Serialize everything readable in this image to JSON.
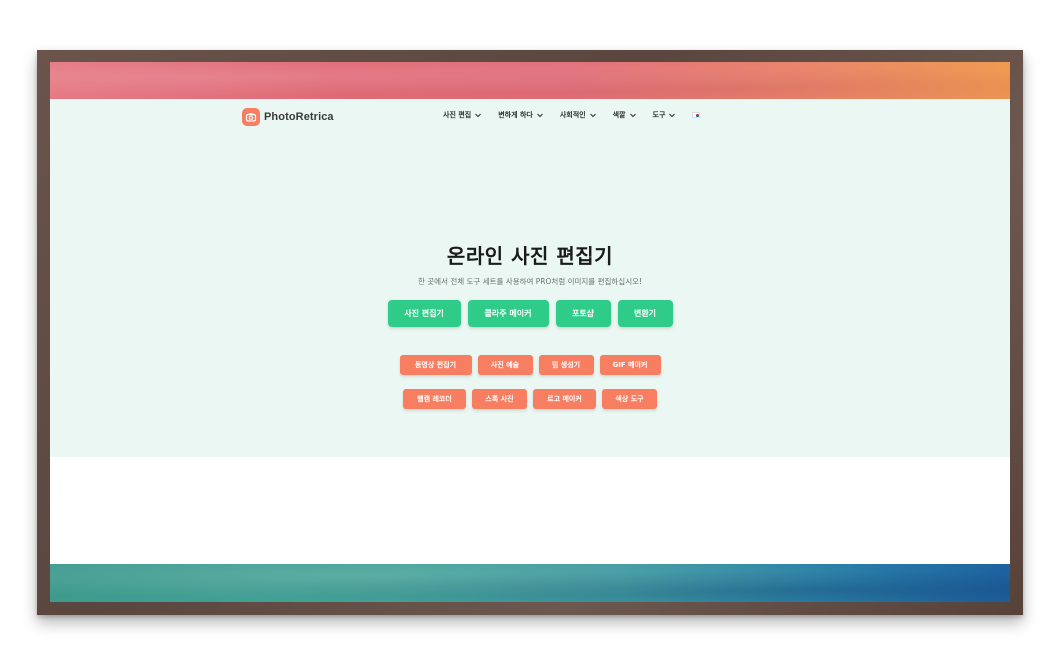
{
  "brand": {
    "name": "PhotoRetrica",
    "accent": "#f87e62"
  },
  "nav": {
    "items": [
      {
        "label": "사진 편집"
      },
      {
        "label": "변하게 하다"
      },
      {
        "label": "사회적인"
      },
      {
        "label": "색깔"
      },
      {
        "label": "도구"
      }
    ],
    "language_icon": "korean-flag-icon"
  },
  "hero": {
    "title": "온라인 사진 편집기",
    "subtitle": "한 곳에서 전체 도구 세트를 사용하여 PRO처럼 이미지를 편집하십시오!"
  },
  "primary_buttons": [
    {
      "label": "사진 편집기"
    },
    {
      "label": "콜라주 메이커"
    },
    {
      "label": "포토샵"
    },
    {
      "label": "변환기"
    }
  ],
  "secondary_buttons_row1": [
    {
      "label": "동영상 편집기"
    },
    {
      "label": "사진 예술"
    },
    {
      "label": "밈 생성기"
    },
    {
      "label": "GIF 메이커"
    }
  ],
  "secondary_buttons_row2": [
    {
      "label": "웹캠 레코더"
    },
    {
      "label": "스톡 사진"
    },
    {
      "label": "로고 메이커"
    },
    {
      "label": "색상 도구"
    }
  ],
  "colors": {
    "primary_button": "#2ecb89",
    "secondary_button": "#f87e62",
    "hero_background": "#ebf7f2",
    "frame": "#5e4a42"
  }
}
